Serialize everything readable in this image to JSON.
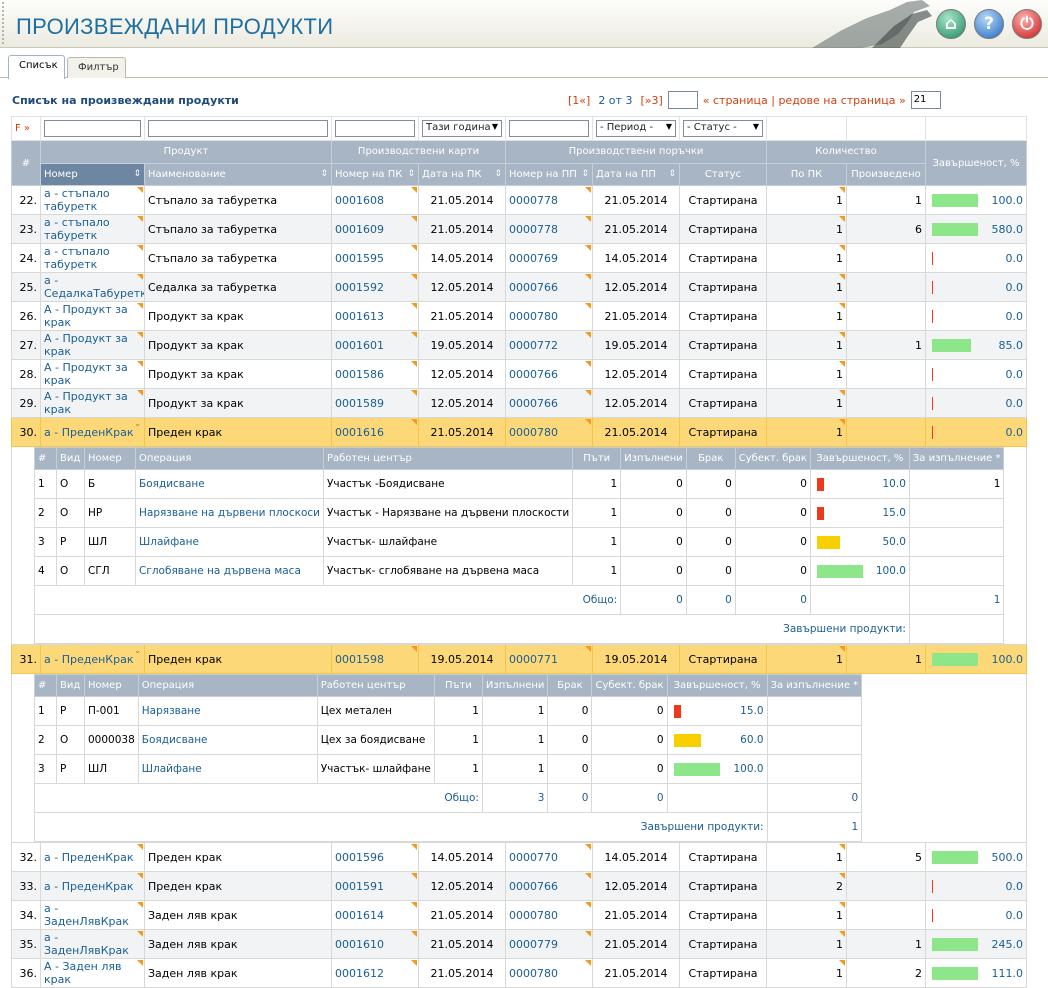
{
  "header": {
    "title": "ПРОИЗВЕЖДАНИ ПРОДУКТИ"
  },
  "tabs": [
    {
      "label": "Списък"
    },
    {
      "label": "Филтър"
    }
  ],
  "list_title": "Списък на произвеждани продукти",
  "pager": {
    "first": "[1«]",
    "current": "2 от 3",
    "last": "[»3]",
    "page_label": "« страница | редове на страница »",
    "rows_per_page": "21"
  },
  "filters": {
    "marker": "F »",
    "period_label": "Тази година",
    "period2_label": "- Период -",
    "status_label": "- Статус -"
  },
  "columns": {
    "group_product": "Продукт",
    "group_cards": "Производствени карти",
    "group_orders": "Производствени поръчки",
    "group_qty": "Количество",
    "completion": "Завършеност, %",
    "num": "#",
    "number": "Номер",
    "name": "Наименование",
    "pk_no": "Номер на ПК",
    "pk_date": "Дата на ПК",
    "pp_no": "Номер на ПП",
    "pp_date": "Дата на ПП",
    "status": "Статус",
    "by_pk": "По ПК",
    "produced": "Произведено"
  },
  "rows": [
    {
      "n": "22.",
      "code": "а - стъпало табуретк",
      "name": "Стъпало за табуретка",
      "pk": "0001608",
      "pkd": "21.05.2014",
      "pp": "0000778",
      "ppd": "21.05.2014",
      "status": "Стартирана",
      "qty": "1",
      "made": "1",
      "pct": "100.0"
    },
    {
      "n": "23.",
      "code": "а - стъпало табуретк",
      "name": "Стъпало за табуретка",
      "pk": "0001609",
      "pkd": "21.05.2014",
      "pp": "0000778",
      "ppd": "21.05.2014",
      "status": "Стартирана",
      "qty": "1",
      "made": "6",
      "pct": "580.0"
    },
    {
      "n": "24.",
      "code": "а - стъпало табуретк",
      "name": "Стъпало за табуретка",
      "pk": "0001595",
      "pkd": "14.05.2014",
      "pp": "0000769",
      "ppd": "14.05.2014",
      "status": "Стартирана",
      "qty": "1",
      "made": "",
      "pct": "0.0"
    },
    {
      "n": "25.",
      "code": "а - СедалкаТабуретка",
      "name": "Седалка за табуретка",
      "pk": "0001592",
      "pkd": "12.05.2014",
      "pp": "0000766",
      "ppd": "12.05.2014",
      "status": "Стартирана",
      "qty": "1",
      "made": "",
      "pct": "0.0"
    },
    {
      "n": "26.",
      "code": "А - Продукт за крак",
      "name": "Продукт за крак",
      "pk": "0001613",
      "pkd": "21.05.2014",
      "pp": "0000780",
      "ppd": "21.05.2014",
      "status": "Стартирана",
      "qty": "1",
      "made": "",
      "pct": "0.0"
    },
    {
      "n": "27.",
      "code": "А - Продукт за крак",
      "name": "Продукт за крак",
      "pk": "0001601",
      "pkd": "19.05.2014",
      "pp": "0000772",
      "ppd": "19.05.2014",
      "status": "Стартирана",
      "qty": "1",
      "made": "1",
      "pct": "85.0"
    },
    {
      "n": "28.",
      "code": "А - Продукт за крак",
      "name": "Продукт за крак",
      "pk": "0001586",
      "pkd": "12.05.2014",
      "pp": "0000766",
      "ppd": "12.05.2014",
      "status": "Стартирана",
      "qty": "1",
      "made": "",
      "pct": "0.0"
    },
    {
      "n": "29.",
      "code": "А - Продукт за крак",
      "name": "Продукт за крак",
      "pk": "0001589",
      "pkd": "12.05.2014",
      "pp": "0000766",
      "ppd": "12.05.2014",
      "status": "Стартирана",
      "qty": "1",
      "made": "",
      "pct": "0.0"
    },
    {
      "n": "30.",
      "code": "а - ПреденКрак",
      "name": "Преден крак",
      "pk": "0001616",
      "pkd": "21.05.2014",
      "pp": "0000780",
      "ppd": "21.05.2014",
      "status": "Стартирана",
      "qty": "1",
      "made": "",
      "pct": "0.0"
    },
    {
      "n": "31.",
      "code": "а - ПреденКрак",
      "name": "Преден крак",
      "pk": "0001598",
      "pkd": "19.05.2014",
      "pp": "0000771",
      "ppd": "19.05.2014",
      "status": "Стартирана",
      "qty": "1",
      "made": "1",
      "pct": "100.0"
    },
    {
      "n": "32.",
      "code": "а - ПреденКрак",
      "name": "Преден крак",
      "pk": "0001596",
      "pkd": "14.05.2014",
      "pp": "0000770",
      "ppd": "14.05.2014",
      "status": "Стартирана",
      "qty": "1",
      "made": "5",
      "pct": "500.0"
    },
    {
      "n": "33.",
      "code": "а - ПреденКрак",
      "name": "Преден крак",
      "pk": "0001591",
      "pkd": "12.05.2014",
      "pp": "0000766",
      "ppd": "12.05.2014",
      "status": "Стартирана",
      "qty": "2",
      "made": "",
      "pct": "0.0"
    },
    {
      "n": "34.",
      "code": "а - ЗаденЛявКрак",
      "name": "Заден ляв крак",
      "pk": "0001614",
      "pkd": "21.05.2014",
      "pp": "0000780",
      "ppd": "21.05.2014",
      "status": "Стартирана",
      "qty": "1",
      "made": "",
      "pct": "0.0"
    },
    {
      "n": "35.",
      "code": "а - ЗаденЛявКрак",
      "name": "Заден ляв крак",
      "pk": "0001610",
      "pkd": "21.05.2014",
      "pp": "0000779",
      "ppd": "21.05.2014",
      "status": "Стартирана",
      "qty": "1",
      "made": "1",
      "pct": "245.0"
    },
    {
      "n": "36.",
      "code": "А - Заден ляв крак",
      "name": "Заден ляв крак",
      "pk": "0001612",
      "pkd": "21.05.2014",
      "pp": "0000780",
      "ppd": "21.05.2014",
      "status": "Стартирана",
      "qty": "1",
      "made": "2",
      "pct": "111.0"
    }
  ],
  "sub_cols": {
    "num": "#",
    "kind": "Вид",
    "number": "Номер",
    "op": "Операция",
    "wc": "Работен център",
    "runs": "Пъти",
    "done": "Изпълнени",
    "scrap": "Брак",
    "subj_scrap": "Субект. брак",
    "completion": "Завършеност, %",
    "todo": "За изпълнение *"
  },
  "sub1": {
    "ops": [
      {
        "n": "1",
        "kind": "О",
        "no": "Б",
        "op": "Боядисване",
        "wc": "Участък -Боядисване",
        "runs": "1",
        "done": "0",
        "scrap": "0",
        "subj": "0",
        "pct": "10.0",
        "todo": "1"
      },
      {
        "n": "2",
        "kind": "О",
        "no": "НР",
        "op": "Нарязване на дървени плоскоси",
        "wc": "Участък - Нарязване на дървени плоскости",
        "runs": "1",
        "done": "0",
        "scrap": "0",
        "subj": "0",
        "pct": "15.0",
        "todo": ""
      },
      {
        "n": "3",
        "kind": "Р",
        "no": "ШЛ",
        "op": "Шлайфане",
        "wc": "Участък- шлайфане",
        "runs": "1",
        "done": "0",
        "scrap": "0",
        "subj": "0",
        "pct": "50.0",
        "todo": ""
      },
      {
        "n": "4",
        "kind": "О",
        "no": "СГЛ",
        "op": "Сглобяване на дървена маса",
        "wc": "Участък- сглобяване на дървена маса",
        "runs": "1",
        "done": "0",
        "scrap": "0",
        "subj": "0",
        "pct": "100.0",
        "todo": ""
      }
    ],
    "total_label": "Общо:",
    "total_done": "0",
    "total_scrap": "0",
    "total_subj": "0",
    "total_todo": "1",
    "finished_label": "Завършени продукти:",
    "finished": ""
  },
  "sub2": {
    "ops": [
      {
        "n": "1",
        "kind": "Р",
        "no": "П-001",
        "op": "Нарязване",
        "wc": "Цех метален",
        "runs": "1",
        "done": "1",
        "scrap": "0",
        "subj": "0",
        "pct": "15.0",
        "todo": ""
      },
      {
        "n": "2",
        "kind": "О",
        "no": "0000038",
        "op": "Боядисване",
        "wc": "Цех за боядисване",
        "runs": "1",
        "done": "1",
        "scrap": "0",
        "subj": "0",
        "pct": "60.0",
        "todo": ""
      },
      {
        "n": "3",
        "kind": "Р",
        "no": "ШЛ",
        "op": "Шлайфане",
        "wc": "Участък- шлайфане",
        "runs": "1",
        "done": "1",
        "scrap": "0",
        "subj": "0",
        "pct": "100.0",
        "todo": ""
      }
    ],
    "total_label": "Общо:",
    "total_done": "3",
    "total_scrap": "0",
    "total_subj": "0",
    "total_todo": "0",
    "finished_label": "Завършени продукти:",
    "finished": "1"
  },
  "colors": {
    "accent": "#1f6fa0",
    "header_grid": "#a7b5c4",
    "highlight": "#fdd879",
    "bar_green": "#8ee68a",
    "bar_red": "#ee3a1c",
    "bar_yellow": "#f8d000"
  }
}
